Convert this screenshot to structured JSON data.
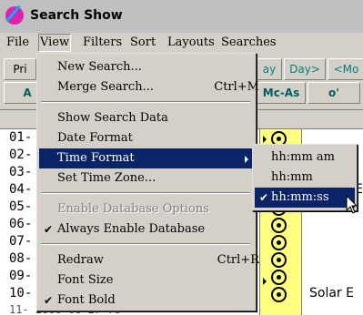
{
  "window": {
    "title": "Search Show"
  },
  "menubar": [
    "File",
    "View",
    "Filters",
    "Sort",
    "Layouts",
    "Searches"
  ],
  "toolbar": {
    "row1": [
      "Pri",
      "ay",
      "Day>",
      "<Mo"
    ],
    "row2": [
      "A",
      "Mc-As",
      "o'"
    ]
  },
  "table": {
    "header_event": "ent",
    "row_numbers": [
      "01-",
      "02-",
      "03-",
      "04-",
      "05-",
      "06-",
      "07-",
      "08-",
      "09-",
      "10-"
    ],
    "side_text_row4": "E",
    "side_text_row10": "Solar E",
    "partial_last_row": "11- 2000 06 27 78"
  },
  "view_menu": {
    "items": [
      {
        "label": "New Search...",
        "shortcut": ""
      },
      {
        "label": "Merge Search...",
        "shortcut": "Ctrl+M"
      },
      {
        "label": "Show Search Data",
        "shortcut": ""
      },
      {
        "label": "Date Format",
        "shortcut": "",
        "submenu": true
      },
      {
        "label": "Time Format",
        "shortcut": "",
        "submenu": true,
        "highlighted": true
      },
      {
        "label": "Set Time Zone...",
        "shortcut": ""
      },
      {
        "label": "Enable Database Options",
        "disabled": true
      },
      {
        "label": "Always Enable Database",
        "checked": true
      },
      {
        "label": "Redraw",
        "shortcut": "Ctrl+R"
      },
      {
        "label": "Font Size",
        "submenu": true
      },
      {
        "label": "Font Bold",
        "checked": true
      }
    ]
  },
  "time_format_submenu": {
    "items": [
      {
        "label": "hh:mm am"
      },
      {
        "label": "hh:mm"
      },
      {
        "label": "hh:mm:ss",
        "checked": true,
        "highlighted": true
      }
    ]
  },
  "colors": {
    "highlight": "#0a246a",
    "event_column": "#ffff80",
    "teal_text": "#008080"
  }
}
